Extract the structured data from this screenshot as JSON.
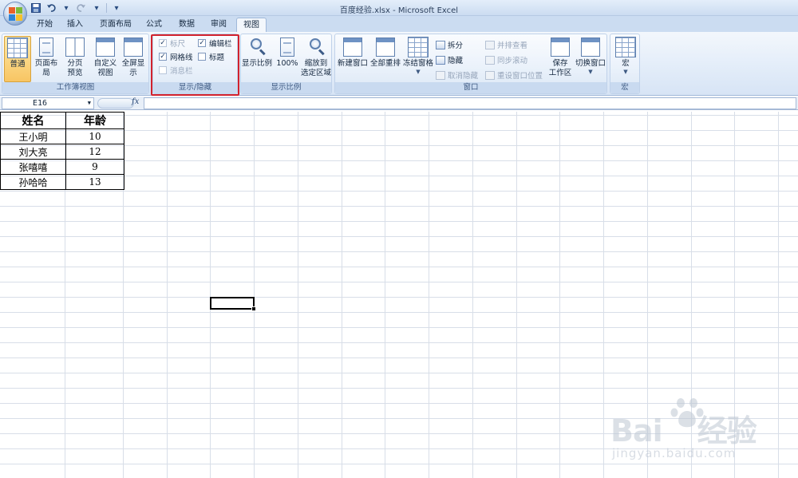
{
  "window": {
    "title": "百度经验.xlsx - Microsoft Excel"
  },
  "qat": {
    "items": [
      "save-icon",
      "undo-icon",
      "redo-icon",
      "customize-icon"
    ]
  },
  "tabs": [
    {
      "label": "开始"
    },
    {
      "label": "插入"
    },
    {
      "label": "页面布局"
    },
    {
      "label": "公式"
    },
    {
      "label": "数据"
    },
    {
      "label": "审阅"
    },
    {
      "label": "视图",
      "active": true
    }
  ],
  "ribbon": {
    "workbook_views": {
      "label": "工作簿视图",
      "normal": "普通",
      "page_layout": "页面布局",
      "page_break_line1": "分页",
      "page_break_line2": "预览",
      "custom_line1": "自定义",
      "custom_line2": "视图",
      "fullscreen": "全屏显示"
    },
    "show_hide": {
      "label": "显示/隐藏",
      "ruler": {
        "label": "标尺",
        "checked": true,
        "disabled": true
      },
      "formula_bar": {
        "label": "编辑栏",
        "checked": true
      },
      "gridlines": {
        "label": "网格线",
        "checked": true
      },
      "headings": {
        "label": "标题",
        "checked": false
      },
      "message_bar": {
        "label": "消息栏",
        "checked": false,
        "disabled": true
      }
    },
    "zoom": {
      "label": "显示比例",
      "zoom": "显示比例",
      "zoom_100": "100%",
      "zoom_sel_line1": "缩放到",
      "zoom_sel_line2": "选定区域"
    },
    "window": {
      "label": "窗口",
      "new_window": "新建窗口",
      "arrange_all": "全部重排",
      "freeze": "冻结窗格",
      "split": "拆分",
      "hide": "隐藏",
      "unhide": "取消隐藏",
      "side_by_side": "并排查看",
      "sync_scroll": "同步滚动",
      "reset_pos": "重设窗口位置",
      "save_ws_line1": "保存",
      "save_ws_line2": "工作区",
      "switch_win": "切换窗口"
    },
    "macros": {
      "label": "宏",
      "macros": "宏"
    }
  },
  "formula_bar": {
    "name_box": "E16",
    "fx": "fx",
    "value": ""
  },
  "sheet": {
    "headers": [
      "姓名",
      "年龄"
    ],
    "rows": [
      [
        "王小明",
        "10"
      ],
      [
        "刘大亮",
        "12"
      ],
      [
        "张嘻嘻",
        "9"
      ],
      [
        "孙哈哈",
        "13"
      ]
    ]
  },
  "watermark": {
    "main": "Bai",
    "main2": "经验",
    "sub": "jingyan.baidu.com"
  },
  "colors": {
    "highlight": "#d2222d",
    "ribbon": "#dbe6f5",
    "accent": "#5d7fae"
  }
}
